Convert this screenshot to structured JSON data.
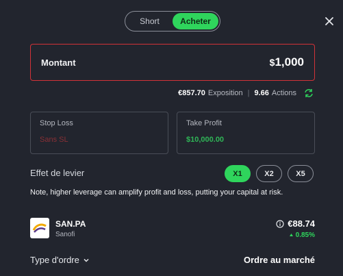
{
  "toggle": {
    "short_label": "Short",
    "buy_label": "Acheter",
    "selected": "Acheter"
  },
  "amount": {
    "label": "Montant",
    "currency": "$",
    "value": "1,000"
  },
  "exposure": {
    "value": "€857.70",
    "label": "Exposition",
    "shares_value": "9.66",
    "shares_label": "Actions"
  },
  "stop_loss": {
    "title": "Stop Loss",
    "value": "Sans SL"
  },
  "take_profit": {
    "title": "Take Profit",
    "value": "$10,000.00"
  },
  "leverage": {
    "label": "Effet de levier",
    "options": [
      "X1",
      "X2",
      "X5"
    ],
    "selected": "X1"
  },
  "note": "Note, higher leverage can amplify profit and loss, putting your capital at risk.",
  "stock": {
    "symbol": "SAN.PA",
    "name": "Sanofi",
    "price": "€88.74",
    "change": "0.85%"
  },
  "order": {
    "label": "Type d'ordre",
    "value": "Ordre au marché"
  },
  "colors": {
    "accent": "#2fd55c",
    "danger": "#d33238",
    "background": "#22252e"
  },
  "icons": {
    "close": "close-icon",
    "refresh": "refresh-icon",
    "info": "info-icon",
    "chevron": "chevron-down-icon",
    "trend": "arrow-up-icon"
  }
}
